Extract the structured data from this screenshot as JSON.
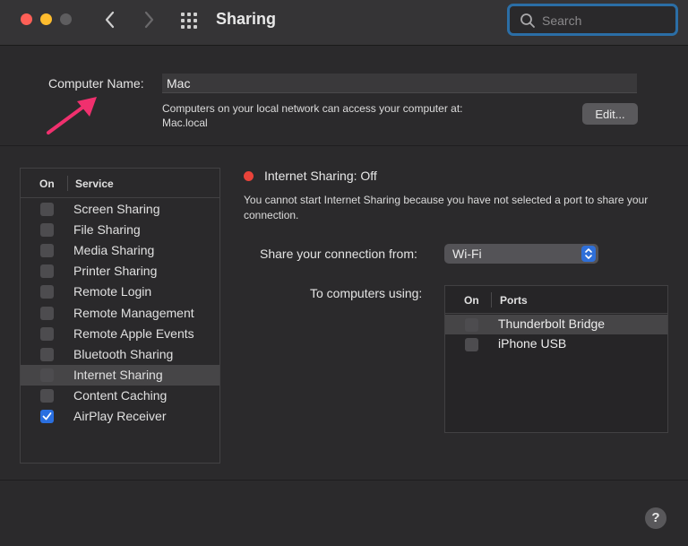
{
  "window": {
    "title": "Sharing"
  },
  "search": {
    "placeholder": "Search"
  },
  "computer_name": {
    "label": "Computer Name:",
    "value": "Mac",
    "access_line1": "Computers on your local network can access your computer at:",
    "access_line2": "Mac.local",
    "edit_label": "Edit..."
  },
  "services": {
    "col_on": "On",
    "col_service": "Service",
    "items": [
      {
        "label": "Screen Sharing",
        "checked": false,
        "selected": false
      },
      {
        "label": "File Sharing",
        "checked": false,
        "selected": false
      },
      {
        "label": "Media Sharing",
        "checked": false,
        "selected": false
      },
      {
        "label": "Printer Sharing",
        "checked": false,
        "selected": false
      },
      {
        "label": "Remote Login",
        "checked": false,
        "selected": false
      },
      {
        "label": "Remote Management",
        "checked": false,
        "selected": false
      },
      {
        "label": "Remote Apple Events",
        "checked": false,
        "selected": false
      },
      {
        "label": "Bluetooth Sharing",
        "checked": false,
        "selected": false
      },
      {
        "label": "Internet Sharing",
        "checked": false,
        "selected": true
      },
      {
        "label": "Content Caching",
        "checked": false,
        "selected": false
      },
      {
        "label": "AirPlay Receiver",
        "checked": true,
        "selected": false
      }
    ]
  },
  "detail": {
    "status": "Internet Sharing: Off",
    "status_color": "#e9433a",
    "description": "You cannot start Internet Sharing because you have not selected a port to share your connection.",
    "share_from_label": "Share your connection from:",
    "share_from_value": "Wi-Fi",
    "to_label": "To computers using:",
    "ports": {
      "col_on": "On",
      "col_ports": "Ports",
      "items": [
        {
          "label": "Thunderbolt Bridge",
          "checked": false,
          "selected": true
        },
        {
          "label": "iPhone USB",
          "checked": false,
          "selected": false
        }
      ]
    }
  },
  "help": {
    "label": "?"
  },
  "colors": {
    "accent": "#2a6fe0",
    "search_focus": "#2b6ea6",
    "annotation_arrow": "#f0306e"
  }
}
